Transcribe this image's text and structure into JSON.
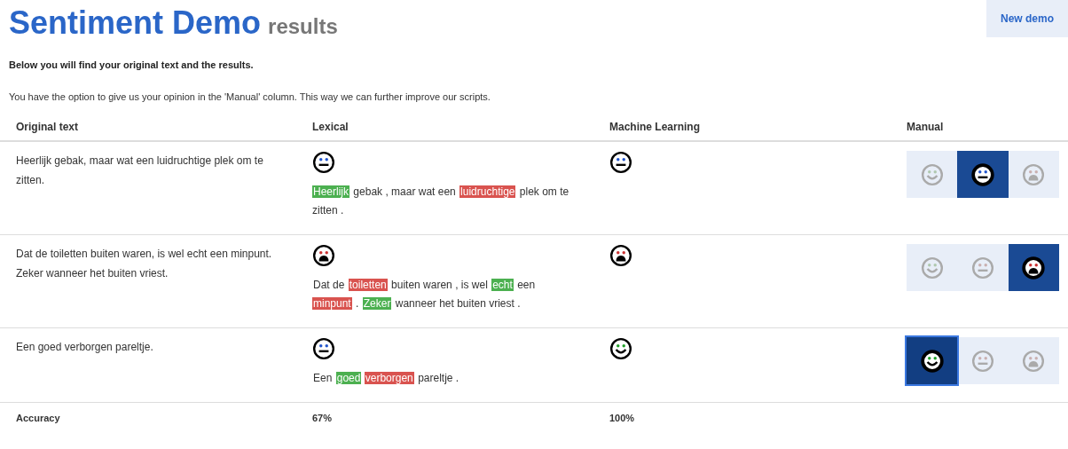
{
  "header": {
    "title": "Sentiment Demo",
    "subtitle": "results",
    "button": "New demo"
  },
  "intro": "Below you will find your original text and the results.",
  "note": "You have the option to give us your opinion in the 'Manual' column. This way we can further improve our scripts.",
  "table": {
    "columns": [
      "Original text",
      "Lexical",
      "Machine Learning",
      "Manual"
    ],
    "rows": [
      {
        "original": "Heerlijk gebak, maar wat een luidruchtige plek om te zitten.",
        "lexical": {
          "kind": "neutral"
        },
        "machine_learning": {
          "kind": "neutral"
        },
        "tokens": [
          {
            "text": "Heerlijk",
            "kind": "positive"
          },
          {
            "text": "gebak , maar wat een",
            "kind": "plain"
          },
          {
            "text": "luidruchtige",
            "kind": "negative"
          },
          {
            "text": "plek om te zitten .",
            "kind": "plain"
          }
        ],
        "manual": [
          {
            "kind": "positive",
            "selected": false
          },
          {
            "kind": "neutral",
            "selected": true
          },
          {
            "kind": "negative",
            "selected": false
          }
        ]
      },
      {
        "original": "Dat de toiletten buiten waren, is wel echt een minpunt. Zeker wanneer het buiten vriest.",
        "lexical": {
          "kind": "negative"
        },
        "machine_learning": {
          "kind": "negative"
        },
        "tokens": [
          {
            "text": "Dat de",
            "kind": "plain"
          },
          {
            "text": "toiletten",
            "kind": "negative"
          },
          {
            "text": "buiten waren , is wel",
            "kind": "plain"
          },
          {
            "text": "echt",
            "kind": "positive"
          },
          {
            "text": "een",
            "kind": "plain"
          },
          {
            "text": "minpunt",
            "kind": "negative"
          },
          {
            "text": ".",
            "kind": "plain"
          },
          {
            "text": "Zeker",
            "kind": "positive"
          },
          {
            "text": "wanneer het buiten vriest .",
            "kind": "plain"
          }
        ],
        "manual": [
          {
            "kind": "positive",
            "selected": false
          },
          {
            "kind": "neutral",
            "selected": false
          },
          {
            "kind": "negative",
            "selected": true
          }
        ]
      },
      {
        "original": "Een goed verborgen pareltje.",
        "lexical": {
          "kind": "neutral"
        },
        "machine_learning": {
          "kind": "positive"
        },
        "tokens": [
          {
            "text": "Een",
            "kind": "plain"
          },
          {
            "text": "goed",
            "kind": "positive"
          },
          {
            "text": "verborgen",
            "kind": "negative"
          },
          {
            "text": "pareltje .",
            "kind": "plain"
          }
        ],
        "manual": [
          {
            "kind": "positive",
            "selected": true
          },
          {
            "kind": "neutral",
            "selected": false
          },
          {
            "kind": "negative",
            "selected": false
          }
        ]
      }
    ],
    "footer": {
      "label": "Accuracy",
      "lexical": "67%",
      "machine_learning": "100%"
    }
  }
}
